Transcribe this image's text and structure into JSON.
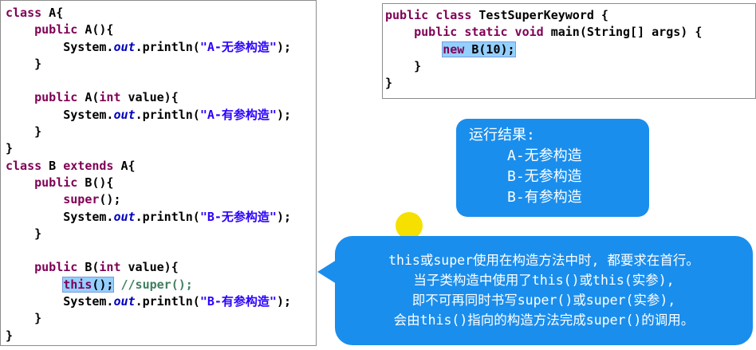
{
  "left_code": {
    "l1_kw": "class",
    "l1_rest": " A{",
    "l2_kw": "public",
    "l2_rest": " A(){",
    "l3_a": "System.",
    "l3_b": "out",
    "l3_c": ".println(",
    "l3_str": "\"A-无参构造\"",
    "l3_d": ");",
    "l4": "}",
    "l6_kw": "public",
    "l6_a": " A(",
    "l6_kw2": "int",
    "l6_b": " value){",
    "l7_a": "System.",
    "l7_b": "out",
    "l7_c": ".println(",
    "l7_str": "\"A-有参构造\"",
    "l7_d": ");",
    "l8": "}",
    "l9": "}",
    "l10_kw": "class",
    "l10_a": " B ",
    "l10_kw2": "extends",
    "l10_b": " A{",
    "l11_kw": "public",
    "l11_rest": " B(){",
    "l12_kw": "super",
    "l12_rest": "();",
    "l13_a": "System.",
    "l13_b": "out",
    "l13_c": ".println(",
    "l13_str": "\"B-无参构造\"",
    "l13_d": ");",
    "l14": "}",
    "l16_kw": "public",
    "l16_a": " B(",
    "l16_kw2": "int",
    "l16_b": " value){",
    "l17_kw": "this",
    "l17_rest": "();",
    "l17_cmt": "//super();",
    "l18_a": "System.",
    "l18_b": "out",
    "l18_c": ".println(",
    "l18_str": "\"B-有参构造\"",
    "l18_d": ");",
    "l19": "}",
    "l20": "}"
  },
  "right_code": {
    "l1_kw": "public class",
    "l1_rest": " TestSuperKeyword {",
    "l2_kw": "public static void",
    "l2_rest": " main(String[] args) {",
    "l3_kw": "new",
    "l3_rest": " B(10);",
    "l4": "}",
    "l5": "}"
  },
  "result_bubble": {
    "title": "运行结果:",
    "line1": "A-无参构造",
    "line2": "B-无参构造",
    "line3": "B-有参构造"
  },
  "rule_bubble": {
    "line1": "this或super使用在构造方法中时, 都要求在首行。",
    "line2": "当子类构造中使用了this()或this(实参),",
    "line3": "即不可再同时书写super()或super(实参),",
    "line4": "会由this()指向的构造方法完成super()的调用。"
  }
}
